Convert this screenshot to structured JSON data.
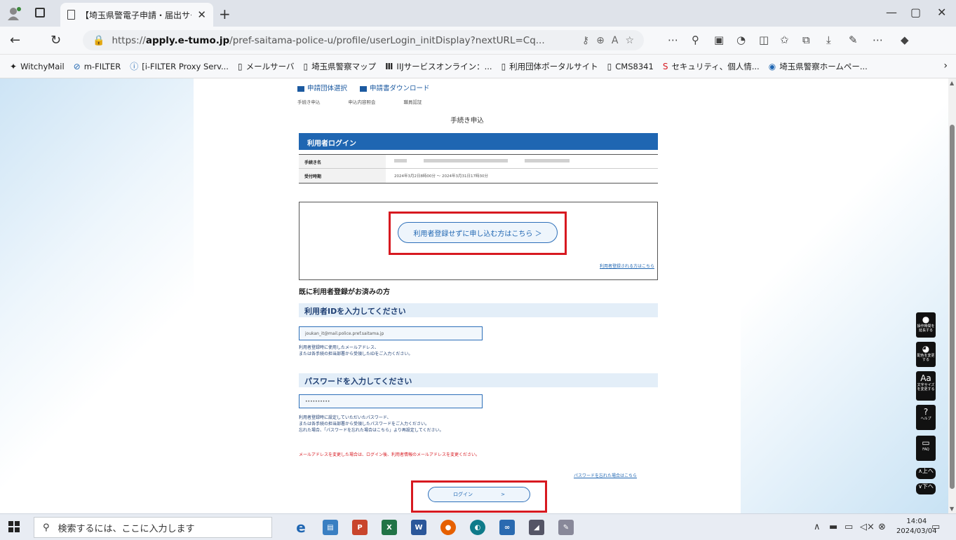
{
  "browser": {
    "tab_title": "【埼玉県警電子申請・届出サービス】",
    "url_prefix": "https://",
    "url_domain": "apply.e-tumo.jp",
    "url_path": "/pref-saitama-police-u/profile/userLogin_initDisplay?nextURL=Cq...",
    "bookmarks": [
      {
        "icon": "witchymail-icon",
        "label": "WitchyMail"
      },
      {
        "icon": "mfilter-icon",
        "label": "m-FILTER"
      },
      {
        "icon": "info-icon",
        "label": "[i-FILTER Proxy Serv..."
      },
      {
        "icon": "page-icon",
        "label": "メールサーバ"
      },
      {
        "icon": "page-icon",
        "label": "埼玉県警察マップ"
      },
      {
        "icon": "iij-icon",
        "label": "IIJサービスオンライン：..."
      },
      {
        "icon": "page-icon",
        "label": "利用団体ポータルサイト"
      },
      {
        "icon": "page-icon",
        "label": "CMS8341"
      },
      {
        "icon": "shield-icon",
        "label": "セキュリティ、個人情..."
      },
      {
        "icon": "police-icon",
        "label": "埼玉県警察ホームペー..."
      }
    ]
  },
  "page": {
    "topnav": [
      "申請団体選択",
      "申請書ダウンロード"
    ],
    "crumbs": [
      "手続き申込",
      "申込内容照会",
      "職員認証"
    ],
    "heading": "手続き申込",
    "login_bar": "利用者ログイン",
    "info_rows": [
      {
        "label": "手続き名",
        "value": ""
      },
      {
        "label": "受付時期",
        "value": "2024年3月2日8時00分 ～ 2024年3月31日17時30分"
      }
    ],
    "noreg_button": "利用者登録せずに申し込む方はこちら ＞",
    "register_link": "利用者登録される方はこちら",
    "registered_title": "既に利用者登録がお済みの方",
    "id_header": "利用者IDを入力してください",
    "id_value": "joukan_it@mail.police.pref.saitama.jp",
    "id_note_1": "利用者登録時に使用したメールアドレス、",
    "id_note_2": "または各手続の担当部署から受領したIDをご入力ください。",
    "pw_header": "パスワードを入力してください",
    "pw_value": "••••••••••",
    "pw_note_1": "利用者登録時に設定していただいたパスワード、",
    "pw_note_2": "または各手続の担当部署から受領したパスワードをご入力ください。",
    "pw_note_3": "忘れた場合、「パスワードを忘れた場合はこちら」より再設定してください。",
    "warning": "メールアドレスを変更した場合は、ログイン後、利用者情報のメールアドレスを変更ください。",
    "forgot_link": "パスワードを忘れた場合はこちら",
    "login_button": "ログイン",
    "login_arrow": ">"
  },
  "side_buttons": [
    {
      "icon": "operation-icon",
      "label": "操作時間を延長する"
    },
    {
      "icon": "palette-icon",
      "label": "配色を変更する"
    },
    {
      "icon": "font-size-icon",
      "label": "文字サイズを変更する"
    },
    {
      "icon": "help-icon",
      "label": "ヘルプ"
    },
    {
      "icon": "faq-icon",
      "label": "FAQ"
    },
    {
      "icon": "up-icon",
      "label": "上へ"
    },
    {
      "icon": "down-icon",
      "label": "下へ"
    }
  ],
  "taskbar": {
    "search_placeholder": "検索するには、ここに入力します",
    "time": "14:04",
    "date": "2024/03/04"
  }
}
